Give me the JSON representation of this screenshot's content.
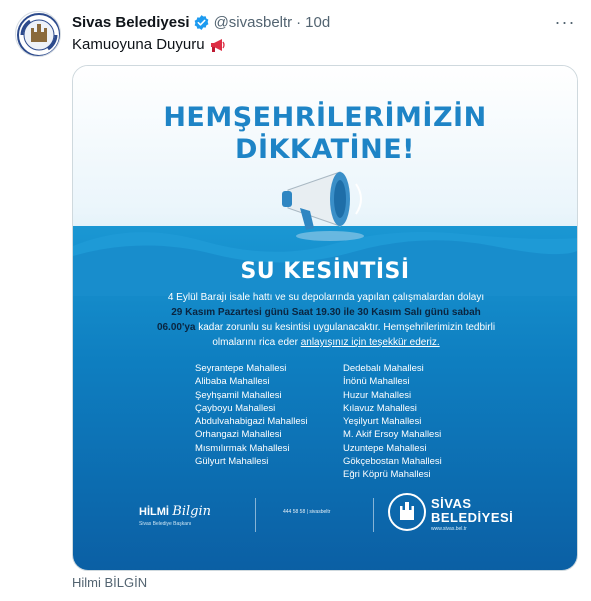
{
  "tweet": {
    "display_name": "Sivas Belediyesi",
    "handle": "@sivasbeltr",
    "separator": "·",
    "time": "10d",
    "text": "Kamuoyuna Duyuru",
    "more_label": "···",
    "avatar_icon": "sivas-belediyesi-logo",
    "verified_color": "#1d9bf0",
    "caption": "Hilmi BİLGİN"
  },
  "poster": {
    "headline_line1": "HEMŞEHRİLERİMİZİN",
    "headline_line2": "DİKKATİNE!",
    "title": "SU KESİNTİSİ",
    "paragraph": {
      "line1": "4 Eylül Barajı isale hattı ve su depolarında yapılan çalışmalardan dolayı",
      "line2_bold": "29 Kasım Pazartesi günü Saat 19.30 ile 30 Kasım Salı günü sabah",
      "line3_bold": "06.00'ya",
      "line3_rest": " kadar zorunlu su kesintisi uygulanacaktır. Hemşehrilerimizin tedbirli",
      "line4_plain": "olmalarını rica eder ",
      "line4_underline": "anlayışınız için teşekkür ederiz."
    },
    "neighborhoods_left": [
      "Seyrantepe Mahallesi",
      "Alibaba Mahallesi",
      "Şeyhşamil Mahallesi",
      "Çayboyu Mahallesi",
      "Abdulvahabigazi Mahallesi",
      "Orhangazi Mahallesi",
      "Mısmılırmak Mahallesi",
      "Gülyurt Mahallesi"
    ],
    "neighborhoods_right": [
      "Dedebalı Mahallesi",
      "İnönü Mahallesi",
      "Huzur Mahallesi",
      "Kılavuz Mahallesi",
      "Yeşilyurt Mahallesi",
      "M. Akif Ersoy Mahallesi",
      "Uzuntepe Mahallesi",
      "Gökçebostan Mahallesi",
      "Eğri Köprü Mahallesi"
    ],
    "signature_first": "HİLMİ",
    "signature_last": "Bilgin",
    "signature_sub": "Sivas Belediye Başkanı",
    "contact": "444 58 58  |  sivasbeltr",
    "logo_line1": "SİVAS",
    "logo_line2": "BELEDİYESİ",
    "logo_url": "www.sivas.bel.tr",
    "colors": {
      "headline": "#1e84c6",
      "water_top": "#1a97d3",
      "water_bottom": "#0b5fa4",
      "emphasis": "#0a2540"
    }
  }
}
